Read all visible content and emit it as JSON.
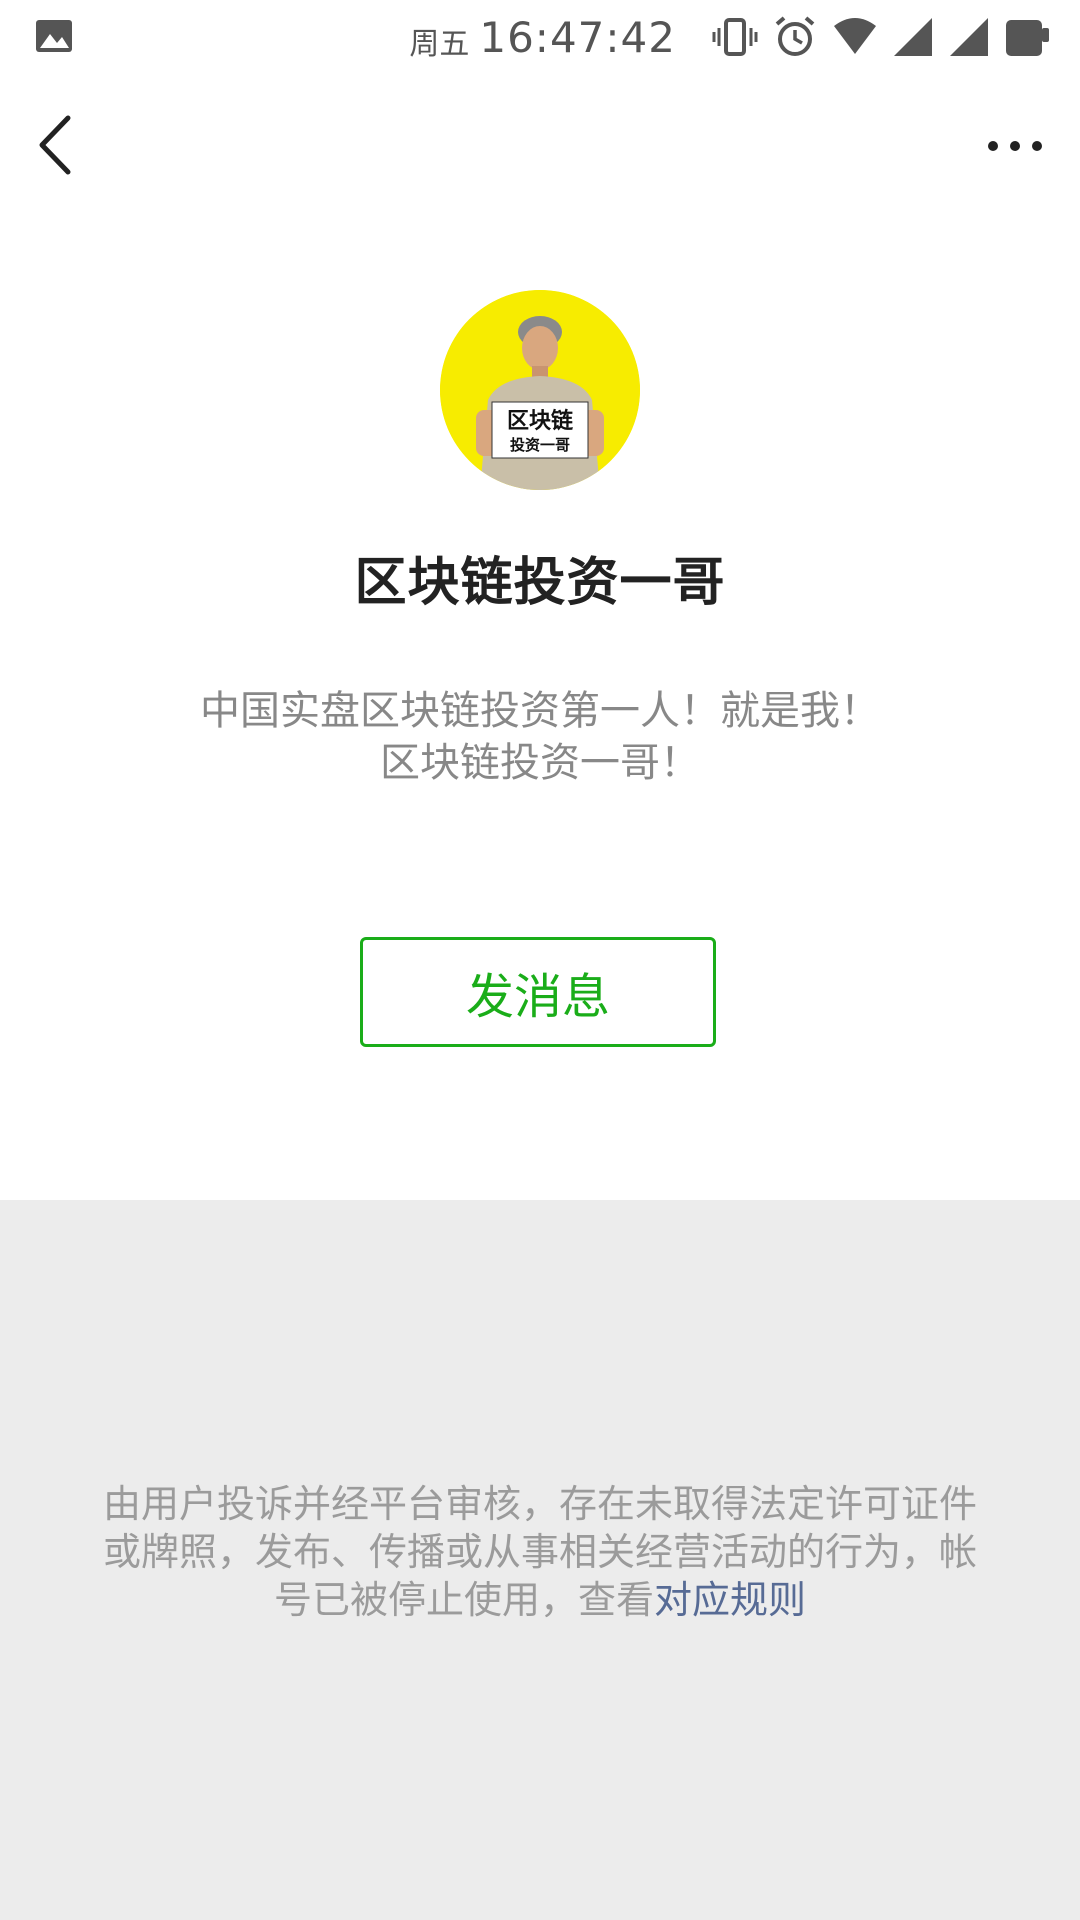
{
  "status_bar": {
    "day": "周五",
    "time": "16:47:42",
    "icons": [
      "gallery-icon",
      "vibrate-icon",
      "alarm-icon",
      "wifi-icon",
      "signal-icon",
      "signal-icon",
      "battery-icon"
    ]
  },
  "nav": {
    "back_icon": "chevron-left-icon",
    "more_icon": "more-dots-icon"
  },
  "profile": {
    "avatar_sign_line1": "区块链",
    "avatar_sign_line2": "投资一哥",
    "name": "区块链投资一哥",
    "bio_line1": "中国实盘区块链投资第一人！就是我！",
    "bio_line2": "区块链投资一哥！"
  },
  "actions": {
    "message_label": "发消息"
  },
  "notice": {
    "line1": "由用户投诉并经平台审核，存在未取得法定许可证件",
    "line2": "或牌照，发布、传播或从事相关经营活动的行为，帐",
    "line3_prefix": "号已被停止使用，查看",
    "rules_link": "对应规则"
  },
  "colors": {
    "accent_green": "#1aad19",
    "link_blue": "#576b95",
    "avatar_bg": "#f7ec00",
    "notice_bg": "#ececec"
  }
}
